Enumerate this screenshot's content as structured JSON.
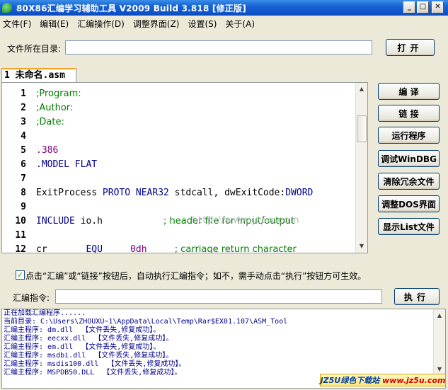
{
  "window": {
    "title": "80X86汇编学习辅助工具    V2009 Build 3.818 [修正版]",
    "min_glyph": "_",
    "max_glyph": "□",
    "close_glyph": "✕"
  },
  "menu": [
    "文件(F)",
    "编辑(E)",
    "汇编操作(D)",
    "调整界面(Z)",
    "设置(S)",
    "关于(A)"
  ],
  "file_dir": {
    "label": "文件所在目录:",
    "value": "",
    "open_label": "打开"
  },
  "tab": {
    "label": "1 未命名.asm"
  },
  "editor": {
    "lines": [
      {
        "num": "1",
        "parts": [
          {
            "t": ";Program:",
            "c": "comment"
          }
        ]
      },
      {
        "num": "2",
        "parts": [
          {
            "t": ";Author:",
            "c": "comment"
          }
        ]
      },
      {
        "num": "3",
        "parts": [
          {
            "t": ";Date:",
            "c": "comment"
          }
        ]
      },
      {
        "num": "4",
        "parts": []
      },
      {
        "num": "5",
        "parts": [
          {
            "t": ".386",
            "c": "dir"
          }
        ]
      },
      {
        "num": "6",
        "parts": [
          {
            "t": ".MODEL FLAT",
            "c": "blue"
          }
        ]
      },
      {
        "num": "7",
        "parts": []
      },
      {
        "num": "8",
        "parts": [
          {
            "t": "ExitProcess ",
            "c": ""
          },
          {
            "t": "PROTO NEAR32",
            "c": "blue"
          },
          {
            "t": " stdcall, dwExitCode:",
            "c": ""
          },
          {
            "t": "DWORD",
            "c": "blue"
          }
        ]
      },
      {
        "num": "9",
        "parts": []
      },
      {
        "num": "10",
        "parts": [
          {
            "t": "INCLUDE",
            "c": "blue"
          },
          {
            "t": " io.h           ",
            "c": ""
          },
          {
            "t": "; header file for input/output",
            "c": "comment"
          }
        ]
      },
      {
        "num": "11",
        "parts": []
      },
      {
        "num": "12",
        "parts": [
          {
            "t": "cr       ",
            "c": ""
          },
          {
            "t": "EQU",
            "c": "blue"
          },
          {
            "t": "     ",
            "c": ""
          },
          {
            "t": "0dh",
            "c": "kw"
          },
          {
            "t": "     ",
            "c": ""
          },
          {
            "t": "; carriage return character",
            "c": "comment"
          }
        ]
      }
    ],
    "watermark": "http://www.jz5u.com"
  },
  "side_buttons": [
    "编  译",
    "链  接",
    "运行程序",
    "调试WinDBG",
    "清除冗余文件",
    "调整DOS界面",
    "显示List文件"
  ],
  "auto_assemble": {
    "checked": true,
    "check_glyph": "✓",
    "text": "点击“汇编”或“链接”按钮后，自动执行汇编指令；如不，需手动点击“执行”按钮方可生效。"
  },
  "command": {
    "label": "汇编指令:",
    "value": "",
    "run_label": "执行"
  },
  "log": [
    "正在加载汇编程序......",
    "当前目录: C:\\Users\\ZHOUXU~1\\AppData\\Local\\Temp\\Rar$EX01.107\\ASM_Tool",
    "汇编主程序: dm.dll  【文件丢失,修复成功】。",
    "汇编主程序: eecxx.dll  【文件丢失,修复成功】。",
    "汇编主程序: em.dll  【文件丢失,修复成功】。",
    "汇编主程序: msdbi.dll  【文件丢失,修复成功】。",
    "汇编主程序: msdis100.dll  【文件丢失,修复成功】。",
    "汇编主程序: MSPDB50.DLL  【文件丢失,修复成功】。"
  ],
  "site_badge": {
    "prefix": "JZ5U绿色下载站",
    "url": "www.jz5u.com"
  },
  "scroll": {
    "up": "▲",
    "down": "▼"
  }
}
